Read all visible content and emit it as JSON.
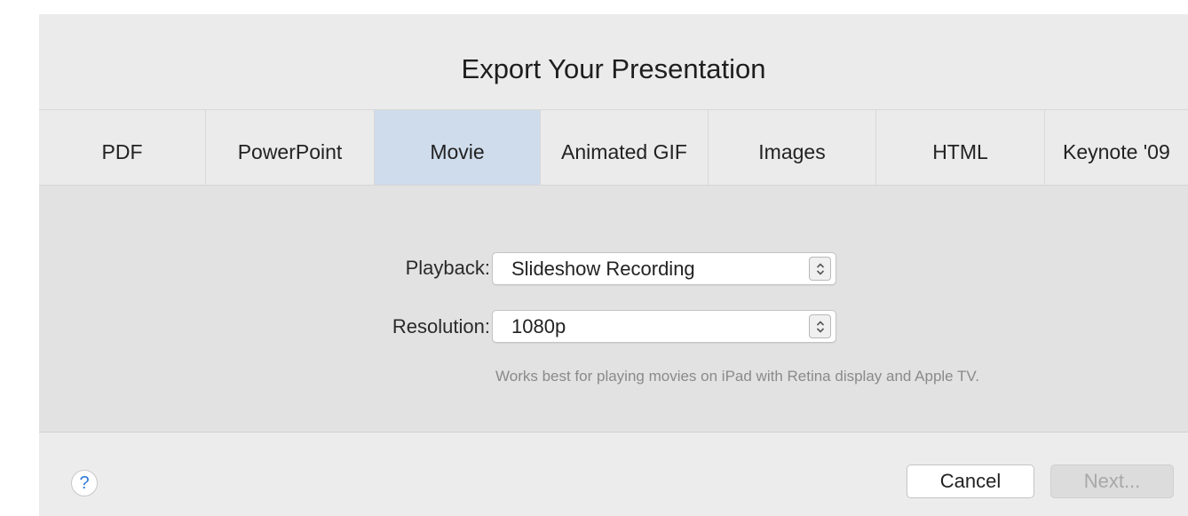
{
  "dialog": {
    "title": "Export Your Presentation"
  },
  "tabs": [
    {
      "label": "PDF"
    },
    {
      "label": "PowerPoint"
    },
    {
      "label": "Movie",
      "selected": true
    },
    {
      "label": "Animated GIF"
    },
    {
      "label": "Images"
    },
    {
      "label": "HTML"
    },
    {
      "label": "Keynote '09"
    }
  ],
  "form": {
    "playback": {
      "label": "Playback:",
      "value": "Slideshow Recording"
    },
    "resolution": {
      "label": "Resolution:",
      "value": "1080p"
    },
    "hint": "Works best for playing movies on iPad with Retina display and Apple TV."
  },
  "footer": {
    "help_label": "?",
    "cancel_label": "Cancel",
    "next_label": "Next..."
  },
  "colors": {
    "selected_tab": "#cfdcec",
    "dialog_bg": "#ebebeb",
    "help_accent": "#2f7bd8"
  }
}
